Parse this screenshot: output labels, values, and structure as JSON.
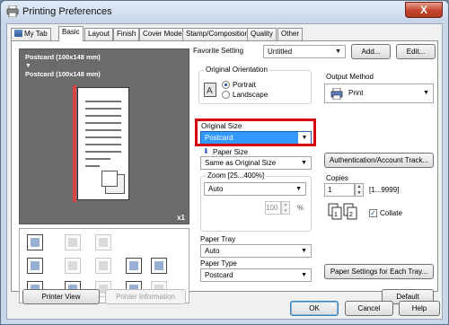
{
  "window": {
    "title": "Printing Preferences",
    "close_label": "X"
  },
  "tabs": [
    {
      "label": "My Tab"
    },
    {
      "label": "Basic"
    },
    {
      "label": "Layout"
    },
    {
      "label": "Finish"
    },
    {
      "label": "Cover Mode"
    },
    {
      "label": "Stamp/Composition"
    },
    {
      "label": "Quality"
    },
    {
      "label": "Other"
    }
  ],
  "preview": {
    "line1": "Postcard (100x148 mm)",
    "arrow": "▼",
    "line2": "Postcard (100x148 mm)",
    "scale": "x1"
  },
  "favorite": {
    "label": "Favorite Setting",
    "value": "Untitled",
    "add_label": "Add...",
    "edit_label": "Edit..."
  },
  "original_orientation": {
    "label": "Original Orientation",
    "portrait_label": "Portrait",
    "landscape_label": "Landscape",
    "selected": "Portrait"
  },
  "original_size": {
    "label": "Original Size",
    "value": "Postcard"
  },
  "paper_size": {
    "label": "Paper Size",
    "value": "Same as Original Size"
  },
  "zoom": {
    "label": "Zoom [25...400%]",
    "mode": "Auto",
    "value": "100",
    "unit": "%"
  },
  "paper_tray": {
    "label": "Paper Tray",
    "value": "Auto"
  },
  "paper_type": {
    "label": "Paper Type",
    "value": "Postcard"
  },
  "output_method": {
    "label": "Output Method",
    "value": "Print"
  },
  "auth_button": "Authentication/Account Track...",
  "copies": {
    "label": "Copies",
    "value": "1",
    "range": "[1...9999]"
  },
  "collate": {
    "label": "Collate",
    "checked": true
  },
  "paper_settings_button": "Paper Settings for Each Tray...",
  "printer_view_button": "Printer View",
  "printer_info_button": "Printer Information",
  "default_button": "Default",
  "footer": {
    "ok": "OK",
    "cancel": "Cancel",
    "help": "Help"
  }
}
